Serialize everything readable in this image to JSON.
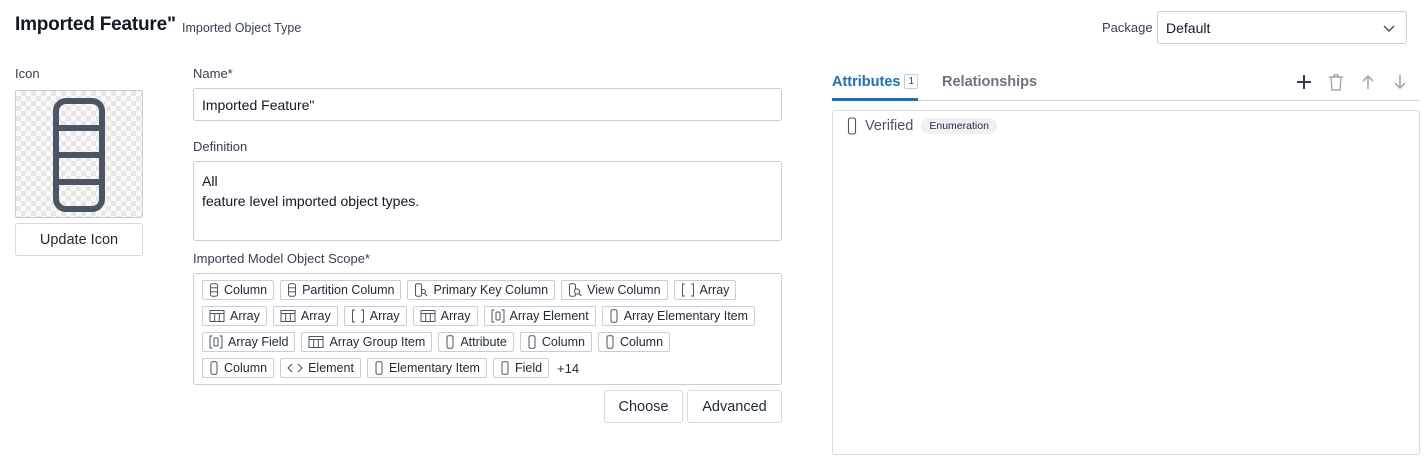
{
  "header": {
    "title": "Imported Feature\"",
    "subtitle": "Imported Object Type",
    "package_label": "Package",
    "package_value": "Default"
  },
  "icon_section": {
    "label": "Icon",
    "icon_name": "column-icon",
    "update_label": "Update Icon"
  },
  "form": {
    "name_label": "Name*",
    "name_value": "Imported Feature\"",
    "definition_label": "Definition",
    "definition_value": "All\nfeature level imported object types.",
    "scope_label": "Imported Model Object Scope*",
    "scope_chips": [
      [
        {
          "label": "Column",
          "icon": "column-icon"
        },
        {
          "label": "Partition Column",
          "icon": "column-icon"
        },
        {
          "label": "Primary Key Column",
          "icon": "key-column-icon"
        },
        {
          "label": "View Column",
          "icon": "view-column-icon"
        },
        {
          "label": "Array",
          "icon": "brackets-icon"
        }
      ],
      [
        {
          "label": "Array",
          "icon": "table-icon"
        },
        {
          "label": "Array",
          "icon": "table-icon"
        },
        {
          "label": "Array",
          "icon": "brackets-icon"
        },
        {
          "label": "Array",
          "icon": "table-icon"
        },
        {
          "label": "Array Element",
          "icon": "array-element-icon"
        },
        {
          "label": "Array Elementary Item",
          "icon": "field-icon"
        }
      ],
      [
        {
          "label": "Array Field",
          "icon": "array-element-icon"
        },
        {
          "label": "Array Group Item",
          "icon": "table-icon"
        },
        {
          "label": "Attribute",
          "icon": "field-icon"
        },
        {
          "label": "Column",
          "icon": "field-icon"
        },
        {
          "label": "Column",
          "icon": "field-icon"
        }
      ],
      [
        {
          "label": "Column",
          "icon": "field-icon"
        },
        {
          "label": "Element",
          "icon": "code-icon"
        },
        {
          "label": "Elementary Item",
          "icon": "field-icon"
        },
        {
          "label": "Field",
          "icon": "field-icon"
        }
      ]
    ],
    "more_count": "+14",
    "choose_label": "Choose",
    "advanced_label": "Advanced"
  },
  "tabs": {
    "attributes_label": "Attributes",
    "attributes_count": "1",
    "relationships_label": "Relationships"
  },
  "attributes": [
    {
      "name": "Verified",
      "type": "Enumeration",
      "icon": "field-icon"
    }
  ],
  "colors": {
    "accent": "#1d6fb8",
    "icon_gray": "#4b5563"
  }
}
